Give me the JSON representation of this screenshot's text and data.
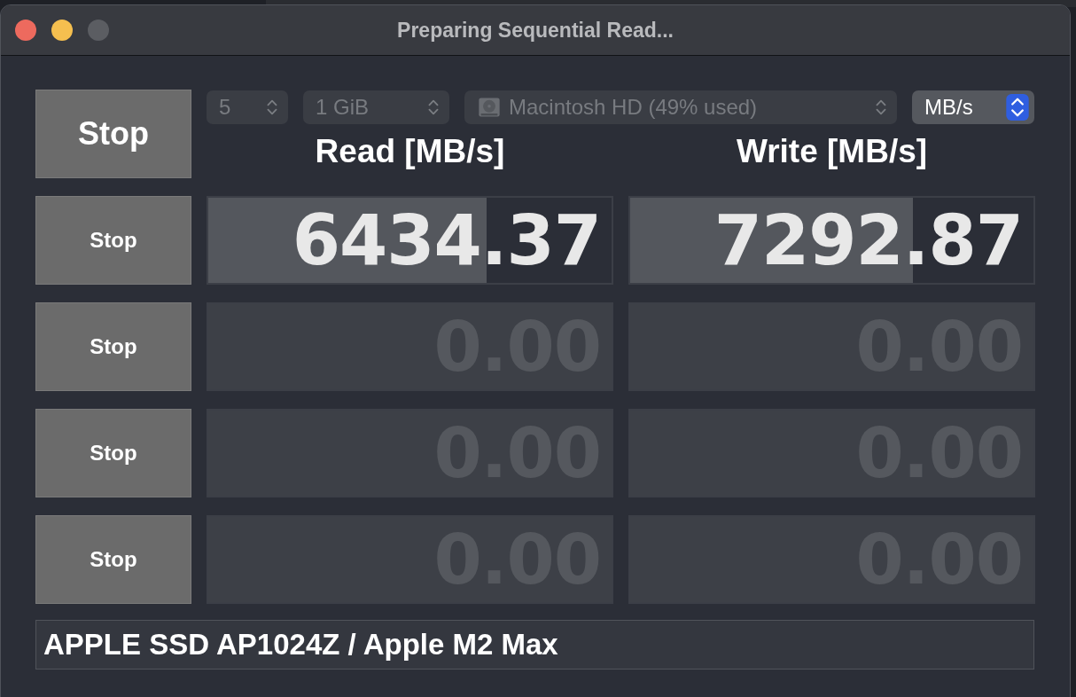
{
  "window": {
    "title": "Preparing Sequential Read..."
  },
  "all_button": "Stop",
  "controls": [
    {
      "kind": "count",
      "value": "5",
      "disabled": true
    },
    {
      "kind": "size",
      "value": "1 GiB",
      "disabled": true
    },
    {
      "kind": "disk",
      "value": "Macintosh HD (49% used)",
      "disabled": true
    },
    {
      "kind": "unit",
      "value": "MB/s",
      "disabled": false
    }
  ],
  "headers": [
    "Read [MB/s]",
    "Write [MB/s]"
  ],
  "rows": [
    {
      "button": "Stop",
      "active": true,
      "read": {
        "value": "6434.37",
        "level": 0.69
      },
      "write": {
        "value": "7292.87",
        "level": 0.7
      }
    },
    {
      "button": "Stop",
      "active": false,
      "read": {
        "value": "0.00"
      },
      "write": {
        "value": "0.00"
      }
    },
    {
      "button": "Stop",
      "active": false,
      "read": {
        "value": "0.00"
      },
      "write": {
        "value": "0.00"
      }
    },
    {
      "button": "Stop",
      "active": false,
      "read": {
        "value": "0.00"
      },
      "write": {
        "value": "0.00"
      }
    }
  ],
  "device": "APPLE SSD AP1024Z / Apple M2 Max"
}
